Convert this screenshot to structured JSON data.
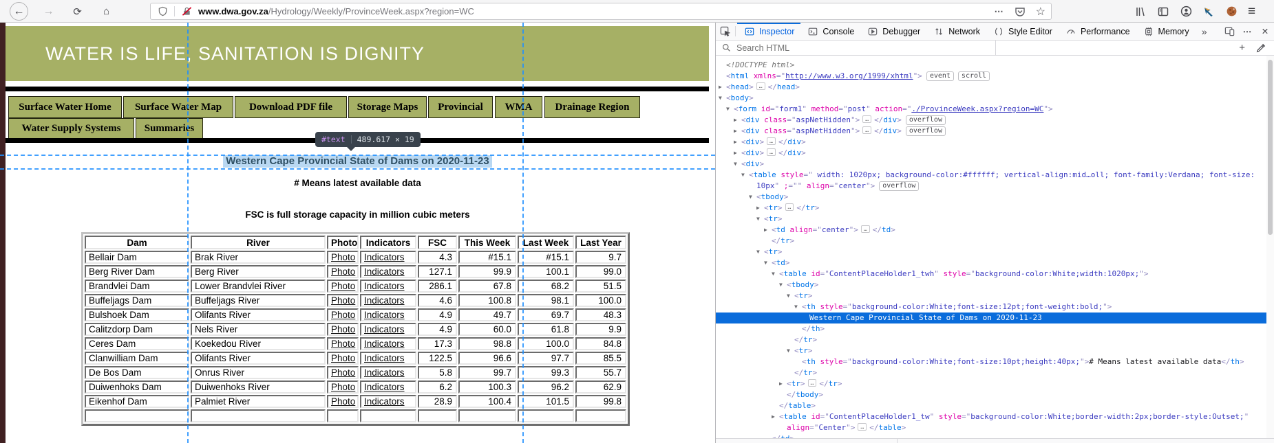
{
  "browser": {
    "url_host": "www.dwa.gov.za",
    "url_path": "/Hydrology/Weekly/ProvinceWeek.aspx?region=WC",
    "icons": {
      "back": "←",
      "forward": "→",
      "reload": "⟳",
      "home": "⌂",
      "page_actions": "⋯",
      "star": "☆",
      "menu": "≡"
    }
  },
  "page": {
    "banner": "WATER IS LIFE, SANITATION IS DIGNITY",
    "nav_row1": [
      "Surface Water Home",
      "Surface Water Map",
      "Download PDF file",
      "Storage Maps",
      "Provincial",
      "WMA",
      "Drainage Region"
    ],
    "nav_row2": [
      "Water Supply Systems",
      "Summaries"
    ],
    "tooltip": {
      "node": "#text",
      "dims": "489.617 × 19"
    },
    "title": "Western Cape Provincial State of Dams on 2020-11-23",
    "note1": "# Means latest available data",
    "note2": "FSC is full storage capacity in million cubic meters"
  },
  "dams_table": {
    "headers": [
      "Dam",
      "River",
      "Photo",
      "Indicators",
      "FSC",
      "This Week",
      "Last Week",
      "Last Year"
    ],
    "photo_label": "Photo",
    "indicators_label": "Indicators",
    "partial_row": true,
    "rows": [
      [
        "Bellair Dam",
        "Brak River",
        "4.3",
        "#15.1",
        "#15.1",
        "9.7"
      ],
      [
        "Berg River Dam",
        "Berg River",
        "127.1",
        "99.9",
        "100.1",
        "99.0"
      ],
      [
        "Brandvlei Dam",
        "Lower Brandvlei River",
        "286.1",
        "67.8",
        "68.2",
        "51.5"
      ],
      [
        "Buffeljags Dam",
        "Buffeljags River",
        "4.6",
        "100.8",
        "98.1",
        "100.0"
      ],
      [
        "Bulshoek Dam",
        "Olifants River",
        "4.9",
        "49.7",
        "69.7",
        "48.3"
      ],
      [
        "Calitzdorp Dam",
        "Nels River",
        "4.9",
        "60.0",
        "61.8",
        "9.9"
      ],
      [
        "Ceres Dam",
        "Koekedou River",
        "17.3",
        "98.8",
        "100.0",
        "84.8"
      ],
      [
        "Clanwilliam Dam",
        "Olifants River",
        "122.5",
        "96.6",
        "97.7",
        "85.5"
      ],
      [
        "De Bos Dam",
        "Onrus River",
        "5.8",
        "99.7",
        "99.3",
        "55.7"
      ],
      [
        "Duiwenhoks Dam",
        "Duiwenhoks River",
        "6.2",
        "100.3",
        "96.2",
        "62.9"
      ],
      [
        "Eikenhof Dam",
        "Palmiet River",
        "28.9",
        "100.4",
        "101.5",
        "99.8"
      ]
    ]
  },
  "devtools": {
    "active_tab": "Inspector",
    "tabs": [
      {
        "label": "Inspector",
        "icon": "inspector-icon"
      },
      {
        "label": "Console",
        "icon": "console-icon"
      },
      {
        "label": "Debugger",
        "icon": "debugger-icon"
      },
      {
        "label": "Network",
        "icon": "network-icon"
      },
      {
        "label": "Style Editor",
        "icon": "style-editor-icon"
      },
      {
        "label": "Performance",
        "icon": "performance-icon"
      },
      {
        "label": "Memory",
        "icon": "memory-icon"
      }
    ],
    "more_tabs_glyph": "»",
    "search_placeholder": "Search HTML",
    "plus_glyph": "+",
    "markup": [
      {
        "i": 0,
        "s": [
          [
            "doc",
            "<!DOCTYPE html>"
          ]
        ]
      },
      {
        "i": 0,
        "s": [
          [
            "p",
            "<"
          ],
          [
            "t",
            "html"
          ],
          [
            "a",
            " xmlns"
          ],
          [
            "p",
            "=\""
          ],
          [
            "lk",
            "http://www.w3.org/1999/xhtml"
          ],
          [
            "p",
            "\">"
          ]
        ],
        "b": [
          "event",
          "scroll"
        ]
      },
      {
        "i": 0,
        "a": "c",
        "s": [
          [
            "p",
            "<"
          ],
          [
            "t",
            "head"
          ],
          [
            "p",
            ">"
          ],
          [
            "el",
            ""
          ],
          [
            "p",
            "</"
          ],
          [
            "t",
            "head"
          ],
          [
            "p",
            ">"
          ]
        ]
      },
      {
        "i": 0,
        "a": "o",
        "s": [
          [
            "p",
            "<"
          ],
          [
            "t",
            "body"
          ],
          [
            "p",
            ">"
          ]
        ]
      },
      {
        "i": 1,
        "a": "o",
        "s": [
          [
            "p",
            "<"
          ],
          [
            "t",
            "form"
          ],
          [
            "a",
            " id"
          ],
          [
            "p",
            "=\""
          ],
          [
            "v",
            "form1"
          ],
          [
            "p",
            "\""
          ],
          [
            "a",
            " method"
          ],
          [
            "p",
            "=\""
          ],
          [
            "v",
            "post"
          ],
          [
            "p",
            "\""
          ],
          [
            "a",
            " action"
          ],
          [
            "p",
            "=\""
          ],
          [
            "lk",
            "./ProvinceWeek.aspx?region=WC"
          ],
          [
            "p",
            "\">"
          ]
        ]
      },
      {
        "i": 2,
        "a": "c",
        "s": [
          [
            "p",
            "<"
          ],
          [
            "t",
            "div"
          ],
          [
            "a",
            " class"
          ],
          [
            "p",
            "=\""
          ],
          [
            "v",
            "aspNetHidden"
          ],
          [
            "p",
            "\">"
          ],
          [
            "el",
            ""
          ],
          [
            "p",
            "</"
          ],
          [
            "t",
            "div"
          ],
          [
            "p",
            ">"
          ]
        ],
        "b": [
          "overflow"
        ]
      },
      {
        "i": 2,
        "a": "c",
        "s": [
          [
            "p",
            "<"
          ],
          [
            "t",
            "div"
          ],
          [
            "a",
            " class"
          ],
          [
            "p",
            "=\""
          ],
          [
            "v",
            "aspNetHidden"
          ],
          [
            "p",
            "\">"
          ],
          [
            "el",
            ""
          ],
          [
            "p",
            "</"
          ],
          [
            "t",
            "div"
          ],
          [
            "p",
            ">"
          ]
        ],
        "b": [
          "overflow"
        ]
      },
      {
        "i": 2,
        "a": "c",
        "s": [
          [
            "p",
            "<"
          ],
          [
            "t",
            "div"
          ],
          [
            "p",
            ">"
          ],
          [
            "el",
            ""
          ],
          [
            "p",
            "</"
          ],
          [
            "t",
            "div"
          ],
          [
            "p",
            ">"
          ]
        ]
      },
      {
        "i": 2,
        "a": "c",
        "s": [
          [
            "p",
            "<"
          ],
          [
            "t",
            "div"
          ],
          [
            "p",
            ">"
          ],
          [
            "el",
            ""
          ],
          [
            "p",
            "</"
          ],
          [
            "t",
            "div"
          ],
          [
            "p",
            ">"
          ]
        ]
      },
      {
        "i": 2,
        "a": "o",
        "s": [
          [
            "p",
            "<"
          ],
          [
            "t",
            "div"
          ],
          [
            "p",
            ">"
          ]
        ]
      },
      {
        "i": 3,
        "a": "o",
        "s": [
          [
            "p",
            "<"
          ],
          [
            "t",
            "table"
          ],
          [
            "a",
            " style"
          ],
          [
            "p",
            "=\""
          ],
          [
            "v",
            " width: 1020px; background-color:#ffffff; vertical-align:mid…oll; font-family:Verdana; font-size:"
          ]
        ]
      },
      {
        "i": 4,
        "s": [
          [
            "v",
            "10px"
          ],
          [
            "p",
            "\" "
          ],
          [
            "a",
            ";"
          ],
          [
            "p",
            "=\"\" "
          ],
          [
            "a",
            "align"
          ],
          [
            "p",
            "=\""
          ],
          [
            "v",
            "center"
          ],
          [
            "p",
            "\">"
          ]
        ],
        "b": [
          "overflow"
        ]
      },
      {
        "i": 4,
        "a": "o",
        "s": [
          [
            "p",
            "<"
          ],
          [
            "t",
            "tbody"
          ],
          [
            "p",
            ">"
          ]
        ]
      },
      {
        "i": 5,
        "a": "c",
        "s": [
          [
            "p",
            "<"
          ],
          [
            "t",
            "tr"
          ],
          [
            "p",
            ">"
          ],
          [
            "el",
            ""
          ],
          [
            "p",
            "</"
          ],
          [
            "t",
            "tr"
          ],
          [
            "p",
            ">"
          ]
        ]
      },
      {
        "i": 5,
        "a": "o",
        "s": [
          [
            "p",
            "<"
          ],
          [
            "t",
            "tr"
          ],
          [
            "p",
            ">"
          ]
        ]
      },
      {
        "i": 6,
        "a": "c",
        "s": [
          [
            "p",
            "<"
          ],
          [
            "t",
            "td"
          ],
          [
            "a",
            " align"
          ],
          [
            "p",
            "=\""
          ],
          [
            "v",
            "center"
          ],
          [
            "p",
            "\">"
          ],
          [
            "el",
            ""
          ],
          [
            "p",
            "</"
          ],
          [
            "t",
            "td"
          ],
          [
            "p",
            ">"
          ]
        ]
      },
      {
        "i": 6,
        "s": [
          [
            "p",
            "</"
          ],
          [
            "t",
            "tr"
          ],
          [
            "p",
            ">"
          ]
        ]
      },
      {
        "i": 5,
        "a": "o",
        "s": [
          [
            "p",
            "<"
          ],
          [
            "t",
            "tr"
          ],
          [
            "p",
            ">"
          ]
        ]
      },
      {
        "i": 6,
        "a": "o",
        "s": [
          [
            "p",
            "<"
          ],
          [
            "t",
            "td"
          ],
          [
            "p",
            ">"
          ]
        ]
      },
      {
        "i": 7,
        "a": "o",
        "s": [
          [
            "p",
            "<"
          ],
          [
            "t",
            "table"
          ],
          [
            "a",
            " id"
          ],
          [
            "p",
            "=\""
          ],
          [
            "v",
            "ContentPlaceHolder1_twh"
          ],
          [
            "p",
            "\""
          ],
          [
            "a",
            " style"
          ],
          [
            "p",
            "=\""
          ],
          [
            "v",
            "background-color:White;width:1020px;"
          ],
          [
            "p",
            "\">"
          ]
        ]
      },
      {
        "i": 8,
        "a": "o",
        "s": [
          [
            "p",
            "<"
          ],
          [
            "t",
            "tbody"
          ],
          [
            "p",
            ">"
          ]
        ]
      },
      {
        "i": 9,
        "a": "o",
        "s": [
          [
            "p",
            "<"
          ],
          [
            "t",
            "tr"
          ],
          [
            "p",
            ">"
          ]
        ]
      },
      {
        "i": 10,
        "a": "o",
        "s": [
          [
            "p",
            "<"
          ],
          [
            "t",
            "th"
          ],
          [
            "a",
            " style"
          ],
          [
            "p",
            "=\""
          ],
          [
            "v",
            "background-color:White;font-size:12pt;font-weight:bold;"
          ],
          [
            "p",
            "\">"
          ]
        ]
      },
      {
        "i": 11,
        "sel": true,
        "s": [
          [
            "tx",
            "Western Cape Provincial State of Dams on 2020-11-23"
          ]
        ]
      },
      {
        "i": 10,
        "s": [
          [
            "p",
            "</"
          ],
          [
            "t",
            "th"
          ],
          [
            "p",
            ">"
          ]
        ]
      },
      {
        "i": 9,
        "s": [
          [
            "p",
            "</"
          ],
          [
            "t",
            "tr"
          ],
          [
            "p",
            ">"
          ]
        ]
      },
      {
        "i": 9,
        "a": "o",
        "s": [
          [
            "p",
            "<"
          ],
          [
            "t",
            "tr"
          ],
          [
            "p",
            ">"
          ]
        ]
      },
      {
        "i": 10,
        "s": [
          [
            "p",
            "<"
          ],
          [
            "t",
            "th"
          ],
          [
            "a",
            " style"
          ],
          [
            "p",
            "=\""
          ],
          [
            "v",
            "background-color:White;font-size:10pt;height:40px;"
          ],
          [
            "p",
            "\">"
          ],
          [
            "tx",
            "# Means latest available data"
          ],
          [
            "p",
            "</"
          ],
          [
            "t",
            "th"
          ],
          [
            "p",
            ">"
          ]
        ]
      },
      {
        "i": 9,
        "s": [
          [
            "p",
            "</"
          ],
          [
            "t",
            "tr"
          ],
          [
            "p",
            ">"
          ]
        ]
      },
      {
        "i": 8,
        "a": "c",
        "s": [
          [
            "p",
            "<"
          ],
          [
            "t",
            "tr"
          ],
          [
            "p",
            ">"
          ],
          [
            "el",
            ""
          ],
          [
            "p",
            "</"
          ],
          [
            "t",
            "tr"
          ],
          [
            "p",
            ">"
          ]
        ]
      },
      {
        "i": 8,
        "s": [
          [
            "p",
            "</"
          ],
          [
            "t",
            "tbody"
          ],
          [
            "p",
            ">"
          ]
        ]
      },
      {
        "i": 7,
        "s": [
          [
            "p",
            "</"
          ],
          [
            "t",
            "table"
          ],
          [
            "p",
            ">"
          ]
        ]
      },
      {
        "i": 7,
        "a": "c",
        "s": [
          [
            "p",
            "<"
          ],
          [
            "t",
            "table"
          ],
          [
            "a",
            " id"
          ],
          [
            "p",
            "=\""
          ],
          [
            "v",
            "ContentPlaceHolder1_tw"
          ],
          [
            "p",
            "\""
          ],
          [
            "a",
            " style"
          ],
          [
            "p",
            "=\""
          ],
          [
            "v",
            "background-color:White;border-width:2px;border-style:Outset;"
          ],
          [
            "p",
            "\""
          ]
        ]
      },
      {
        "i": 8,
        "s": [
          [
            "a",
            "align"
          ],
          [
            "p",
            "=\""
          ],
          [
            "v",
            "Center"
          ],
          [
            "p",
            "\">"
          ],
          [
            "el",
            ""
          ],
          [
            "p",
            "</"
          ],
          [
            "t",
            "table"
          ],
          [
            "p",
            ">"
          ]
        ]
      },
      {
        "i": 6,
        "s": [
          [
            "p",
            "</"
          ],
          [
            "t",
            "td"
          ],
          [
            "p",
            ">"
          ]
        ]
      }
    ]
  }
}
